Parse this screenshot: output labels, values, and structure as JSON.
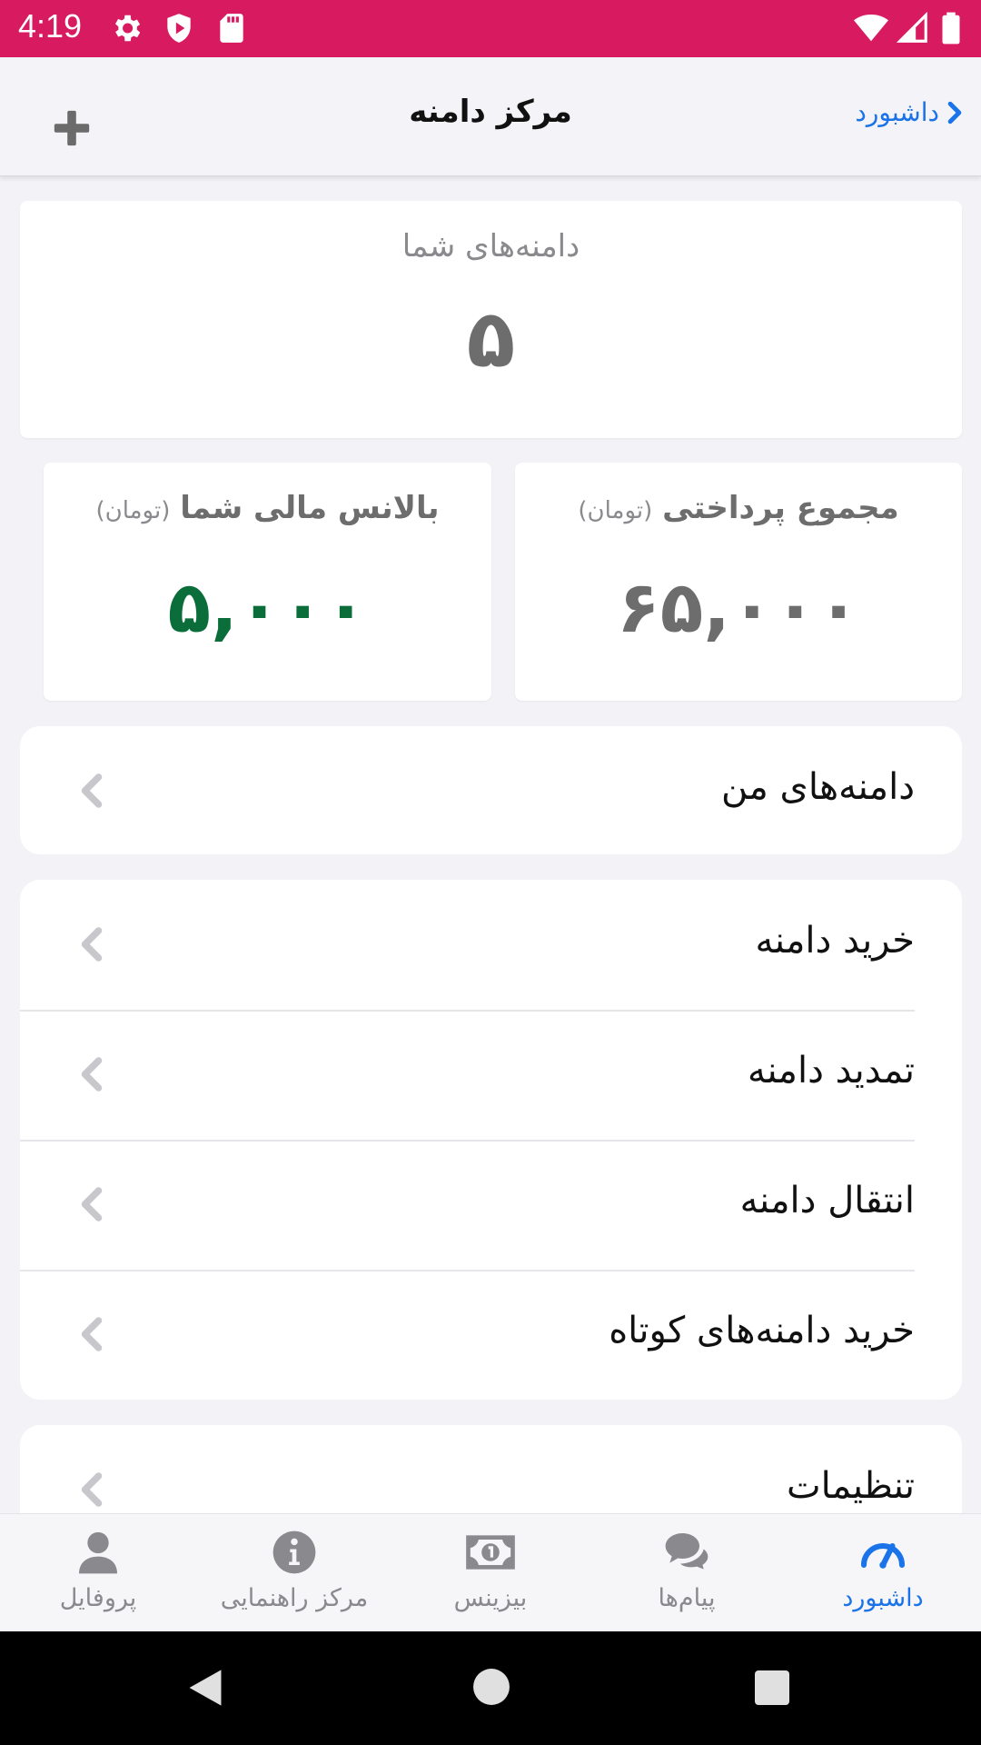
{
  "status_bar": {
    "time": "4:19"
  },
  "navbar": {
    "title": "مرکز دامنه",
    "back_label": "داشبورد"
  },
  "stats": {
    "domains": {
      "title": "دامنه‌های شما",
      "value": "۵"
    },
    "total_paid": {
      "title": "مجموع پرداختی",
      "unit": "(تومان)",
      "value": "۶۵,۰۰۰"
    },
    "balance": {
      "title": "بالانس مالی شما",
      "unit": "(تومان)",
      "value": "۵,۰۰۰"
    }
  },
  "menu": {
    "group1": [
      {
        "label": "دامنه‌های من"
      }
    ],
    "group2": [
      {
        "label": "خرید دامنه"
      },
      {
        "label": "تمدید دامنه"
      },
      {
        "label": "انتقال دامنه"
      },
      {
        "label": "خرید دامنه‌های کوتاه"
      }
    ],
    "group3": [
      {
        "label": "تنظیمات"
      }
    ]
  },
  "tabs": [
    {
      "label": "داشبورد",
      "icon": "dashboard-gauge-icon",
      "active": true
    },
    {
      "label": "پیام‌ها",
      "icon": "chat-bubbles-icon",
      "active": false
    },
    {
      "label": "بیزینس",
      "icon": "money-icon",
      "active": false
    },
    {
      "label": "مرکز راهنمایی",
      "icon": "info-icon",
      "active": false
    },
    {
      "label": "پروفایل",
      "icon": "user-icon",
      "active": false
    }
  ],
  "colors": {
    "status_bar": "#d81b60",
    "accent": "#1a73e8",
    "balance_value": "#0b6e3a",
    "muted": "#8a8a8e"
  }
}
